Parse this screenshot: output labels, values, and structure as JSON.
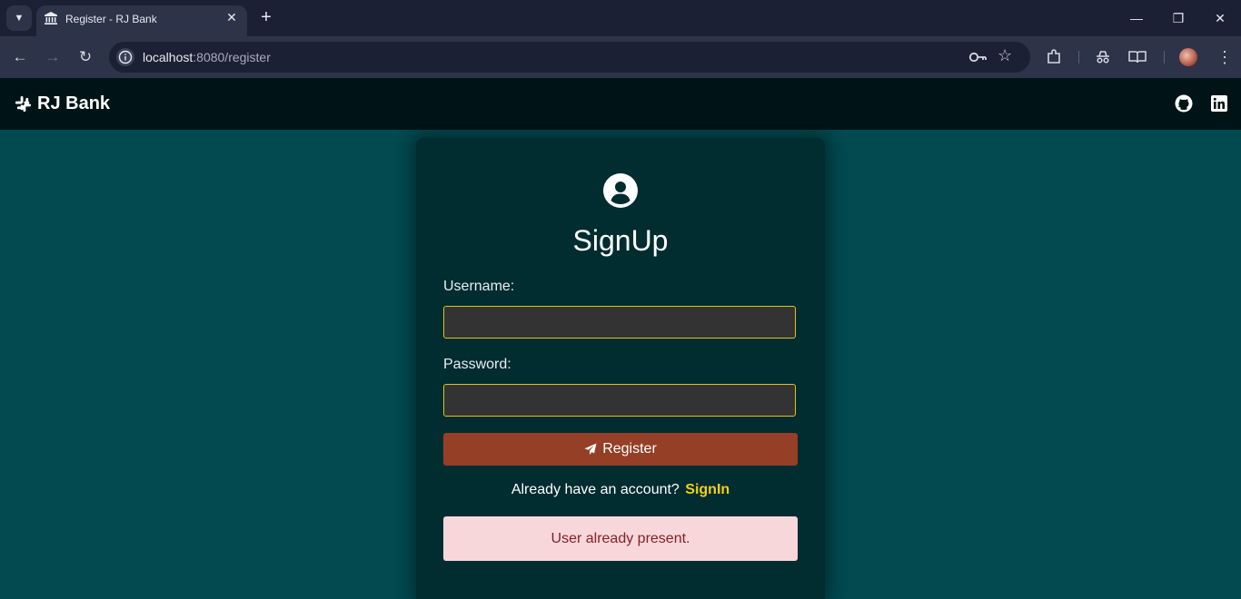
{
  "browser": {
    "tab_title": "Register - RJ Bank",
    "tab_close": "✕",
    "new_tab": "+",
    "url_host": "localhost",
    "url_path": ":8080/register",
    "window": {
      "minimize": "—",
      "restore": "❐",
      "close": "✕"
    },
    "nav": {
      "back": "←",
      "forward": "→",
      "reload": "↻"
    }
  },
  "navbar": {
    "brand": "RJ Bank"
  },
  "form": {
    "title": "SignUp",
    "username_label": "Username:",
    "username_value": "",
    "password_label": "Password:",
    "password_value": "",
    "register_label": "Register",
    "already_text": "Already have an account?",
    "signin_link": "SignIn",
    "alert_message": "User already present."
  },
  "colors": {
    "page_bg": "#024950",
    "navbar_bg": "#001417",
    "card_bg": "#012c30",
    "input_border": "#d9c51e",
    "button_bg": "#953f27",
    "link": "#f2d115",
    "alert_bg": "#f8d7da",
    "alert_text": "#842029"
  },
  "icons": {
    "tab_list": "chevron-down-icon",
    "favicon": "bank-icon",
    "site_info": "info-icon",
    "password_key": "key-icon",
    "bookmark": "star-icon",
    "extensions": "puzzle-icon",
    "incognito_like": "spy-icon",
    "reading_list": "book-icon",
    "menu": "kebab-icon",
    "brand": "slack-icon",
    "github": "github-icon",
    "linkedin": "linkedin-icon",
    "user": "user-circle-icon",
    "send": "paper-plane-icon"
  }
}
